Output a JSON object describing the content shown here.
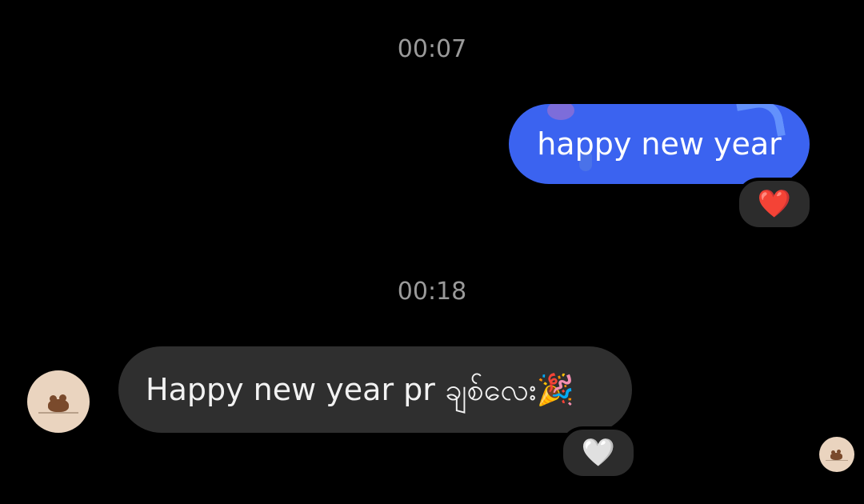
{
  "conversation": {
    "messages": [
      {
        "timestamp": "00:07",
        "direction": "sent",
        "text": "happy new year",
        "reaction": "❤️",
        "bubble_color": "#3b63f0"
      },
      {
        "timestamp": "00:18",
        "direction": "received",
        "text": "Happy new year pr ချစ်လေး🎉",
        "reaction": "🤍",
        "bubble_color": "#2f2f2f"
      }
    ]
  },
  "icons": {
    "sender_avatar": "bear-avatar-icon",
    "read_receipt_avatar": "bear-avatar-icon",
    "sent_reaction": "red-heart-icon",
    "received_reaction": "white-heart-icon"
  },
  "colors": {
    "background": "#000000",
    "timestamp_text": "#9a9a9a",
    "reaction_pill": "#2c2c2c",
    "avatar_background": "#ead4bf"
  }
}
